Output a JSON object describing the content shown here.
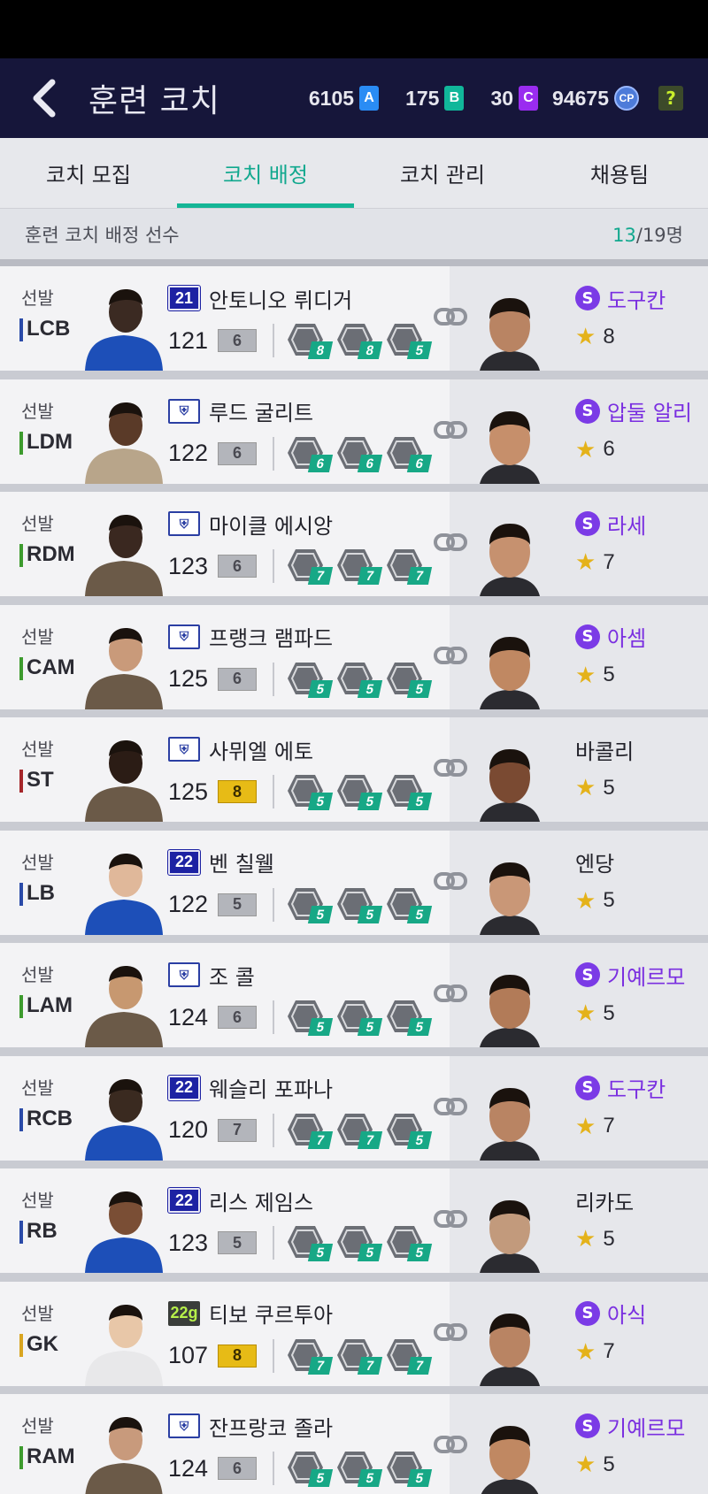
{
  "header": {
    "title": "훈련 코치",
    "currencies": [
      {
        "value": "6105",
        "icon": "A"
      },
      {
        "value": "175",
        "icon": "B"
      },
      {
        "value": "30",
        "icon": "C"
      },
      {
        "value": "94675",
        "icon": "CP"
      }
    ],
    "help": "?"
  },
  "tabs": [
    {
      "label": "코치 모집"
    },
    {
      "label": "코치 배정"
    },
    {
      "label": "코치 관리"
    },
    {
      "label": "채용팀"
    }
  ],
  "subheader": {
    "label": "훈련 코치 배정 선수",
    "assigned": "13",
    "total": "/19명"
  },
  "rows": [
    {
      "status": "선발",
      "position": "LCB",
      "pos_color": "#2a4aa8",
      "season": "21",
      "player": "안토니오 뤼디거",
      "ovr": "121",
      "level": "6",
      "gold": false,
      "skills": [
        "8",
        "8",
        "5"
      ],
      "coach": "도구칸",
      "special": true,
      "stars": "8"
    },
    {
      "status": "선발",
      "position": "LDM",
      "pos_color": "#3d9b2e",
      "season": "icon",
      "player": "루드 굴리트",
      "ovr": "122",
      "level": "6",
      "gold": false,
      "skills": [
        "6",
        "6",
        "6"
      ],
      "coach": "압둘 알리",
      "special": true,
      "stars": "6"
    },
    {
      "status": "선발",
      "position": "RDM",
      "pos_color": "#3d9b2e",
      "season": "icon",
      "player": "마이클 에시앙",
      "ovr": "123",
      "level": "6",
      "gold": false,
      "skills": [
        "7",
        "7",
        "7"
      ],
      "coach": "라세",
      "special": true,
      "stars": "7"
    },
    {
      "status": "선발",
      "position": "CAM",
      "pos_color": "#3d9b2e",
      "season": "icon",
      "player": "프랭크 램파드",
      "ovr": "125",
      "level": "6",
      "gold": false,
      "skills": [
        "5",
        "5",
        "5"
      ],
      "coach": "아셈",
      "special": true,
      "stars": "5"
    },
    {
      "status": "선발",
      "position": "ST",
      "pos_color": "#a5262a",
      "season": "icon",
      "player": "사뮈엘 에토",
      "ovr": "125",
      "level": "8",
      "gold": true,
      "skills": [
        "5",
        "5",
        "5"
      ],
      "coach": "바콜리",
      "special": false,
      "stars": "5"
    },
    {
      "status": "선발",
      "position": "LB",
      "pos_color": "#2a4aa8",
      "season": "22",
      "player": "벤 칠웰",
      "ovr": "122",
      "level": "5",
      "gold": false,
      "skills": [
        "5",
        "5",
        "5"
      ],
      "coach": "엔당",
      "special": false,
      "stars": "5"
    },
    {
      "status": "선발",
      "position": "LAM",
      "pos_color": "#3d9b2e",
      "season": "icon",
      "player": "조 콜",
      "ovr": "124",
      "level": "6",
      "gold": false,
      "skills": [
        "5",
        "5",
        "5"
      ],
      "coach": "기예르모",
      "special": true,
      "stars": "5"
    },
    {
      "status": "선발",
      "position": "RCB",
      "pos_color": "#2a4aa8",
      "season": "22",
      "player": "웨슬리 포파나",
      "ovr": "120",
      "level": "7",
      "gold": false,
      "skills": [
        "7",
        "7",
        "5"
      ],
      "coach": "도구칸",
      "special": true,
      "stars": "7"
    },
    {
      "status": "선발",
      "position": "RB",
      "pos_color": "#2a4aa8",
      "season": "22",
      "player": "리스 제임스",
      "ovr": "123",
      "level": "5",
      "gold": false,
      "skills": [
        "5",
        "5",
        "5"
      ],
      "coach": "리카도",
      "special": false,
      "stars": "5"
    },
    {
      "status": "선발",
      "position": "GK",
      "pos_color": "#d9a520",
      "season": "22g",
      "player": "티보 쿠르투아",
      "ovr": "107",
      "level": "8",
      "gold": true,
      "skills": [
        "7",
        "7",
        "7"
      ],
      "coach": "아식",
      "special": true,
      "stars": "7"
    },
    {
      "status": "선발",
      "position": "RAM",
      "pos_color": "#3d9b2e",
      "season": "icon",
      "player": "잔프랑코 졸라",
      "ovr": "124",
      "level": "6",
      "gold": false,
      "skills": [
        "5",
        "5",
        "5"
      ],
      "coach": "기예르모",
      "special": true,
      "stars": "5"
    }
  ],
  "icons": {
    "back": "chevron-left-icon",
    "link": "link-icon",
    "star": "star-icon",
    "special_badge": "S"
  }
}
